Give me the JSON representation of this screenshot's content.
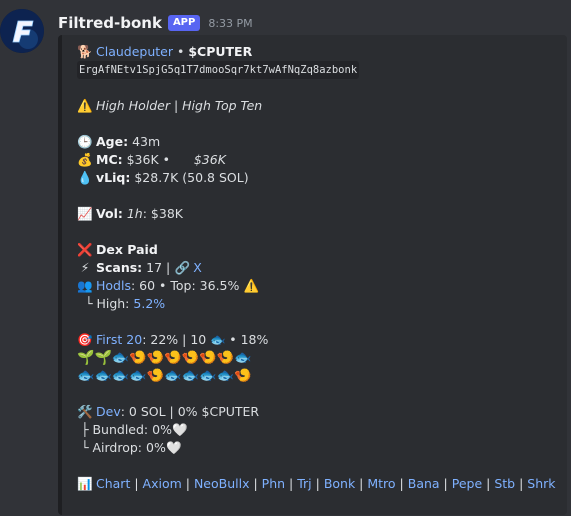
{
  "message": {
    "username": "Filtred-bonk",
    "badge": "APP",
    "time": "8:33 PM"
  },
  "embed": {
    "token_name": "Claudeputer",
    "symbol": "$CPUTER",
    "address": "ErgAfNEtv1SpjG5q1T7dmooSqr7kt7wAfNqZq8azbonk",
    "warning": "High Holder | High Top Ten",
    "age_label": "Age:",
    "age_value": "43m",
    "mc_label": "MC:",
    "mc_value": "$36K",
    "mc_value2": "$36K",
    "vliq_label": "vLiq:",
    "vliq_value": "$28.7K (50.8 SOL)",
    "vol_label": "Vol:",
    "vol_period": "1h",
    "vol_value": ": $38K",
    "dex_paid": "Dex Paid",
    "scans_label": "Scans:",
    "scans_value": "17 |",
    "x_link": "X",
    "hodls_link": "Hodls",
    "hodls_value": ": 60 • Top: 36.5%",
    "high_label": "└ High:",
    "high_value": "5.2%",
    "first20_link": "First 20",
    "first20_value": ": 22% | 10",
    "first20_value2": "• 18%",
    "dev_link": "Dev",
    "dev_value": ": 0 SOL | 0% $CPUTER",
    "bundled": "├ Bundled: 0%",
    "airdrop": "└ Airdrop: 0%",
    "links": [
      "Chart",
      "Axiom",
      "NeoBullx",
      "Phn",
      "Trj",
      "Bonk",
      "Mtro",
      "Bana",
      "Pepe",
      "Stb",
      "Shrk"
    ]
  }
}
